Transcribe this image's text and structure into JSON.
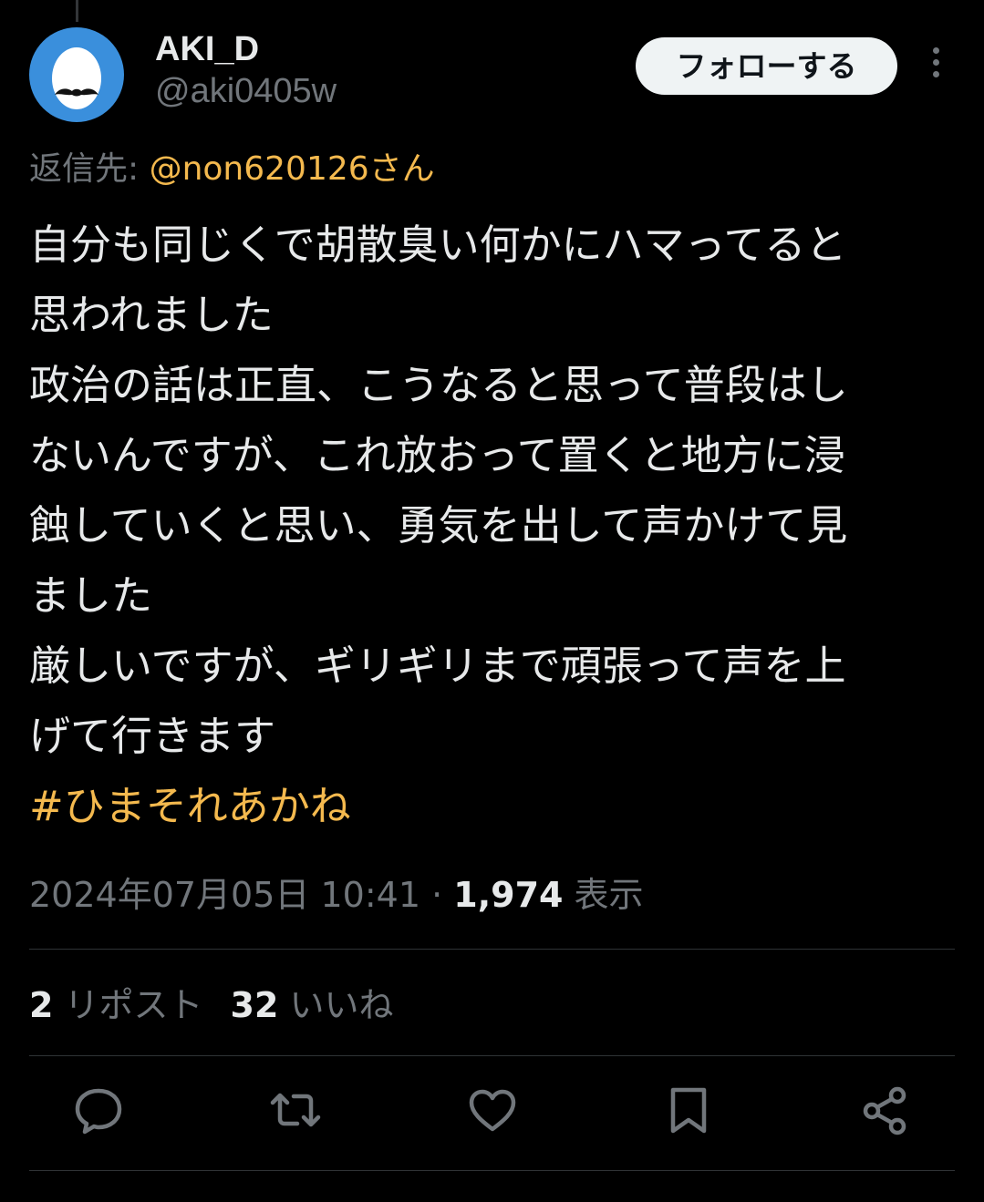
{
  "user": {
    "display_name": "AKI_D",
    "handle": "@aki0405w"
  },
  "header": {
    "follow_label": "フォローする",
    "more_icon": "more-dots-icon"
  },
  "reply": {
    "prefix": "返信先: ",
    "mention": "@non620126さん"
  },
  "tweet": {
    "lines": [
      "自分も同じくで胡散臭い何かにハマってると",
      "思われました",
      "政治の話は正直、こうなると思って普段はし",
      "ないんですが、これ放おって置くと地方に浸",
      "蝕していくと思い、勇気を出して声かけて見",
      "ました",
      "厳しいですが、ギリギリまで頑張って声を上",
      "げて行きます"
    ],
    "hashtag": "#ひまそれあかね"
  },
  "meta": {
    "datetime": "2024年07月05日 10:41",
    "separator": " · ",
    "views_count": "1,974",
    "views_label": " 表示"
  },
  "stats": {
    "reposts_count": "2",
    "reposts_label": " リポスト",
    "likes_count": "32",
    "likes_label": " いいね"
  },
  "actions": [
    {
      "icon": "reply-icon"
    },
    {
      "icon": "repost-icon"
    },
    {
      "icon": "like-icon"
    },
    {
      "icon": "bookmark-icon"
    },
    {
      "icon": "share-icon"
    }
  ],
  "colors": {
    "background": "#000000",
    "text": "#e7e9ea",
    "secondary": "#71767b",
    "accent": "#f4b94e",
    "divider": "#2f3336",
    "avatar_bg": "#3a8fdc"
  }
}
